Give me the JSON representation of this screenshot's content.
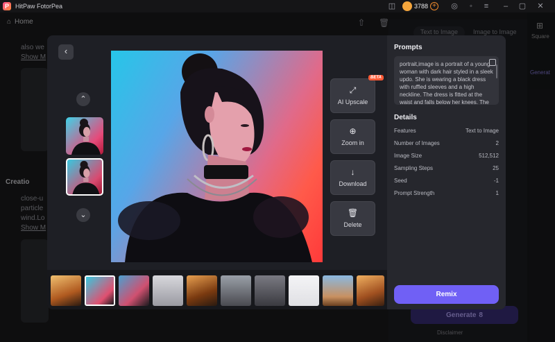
{
  "app": {
    "title": "HitPaw FotorPea",
    "logo": "P",
    "credits": "3788"
  },
  "background": {
    "home_label": "Home",
    "text_1": "also we",
    "link_1": "Show M",
    "creation_label": "Creatio",
    "text_2a": "close-u",
    "text_2b": "particle",
    "text_2c": "wind.Lo",
    "link_2": "Show M",
    "tab_text_to_image": "Text to Image",
    "tab_image_to_image": "Image to Image",
    "sidebar_square": "Square",
    "sidebar_generate": "Generat",
    "generate_label": "Generate",
    "generate_cost": "8",
    "disclaimer": "Disclaimer"
  },
  "modal": {
    "back_icon": "‹",
    "nav_up_icon": "⌃",
    "nav_down_icon": "⌄",
    "actions": [
      {
        "label": "AI Upscale",
        "icon": "⤢"
      },
      {
        "label": "Zoom in",
        "icon": "⊕"
      },
      {
        "label": "Download",
        "icon": "↓"
      },
      {
        "label": "Delete",
        "icon": "🗑"
      }
    ],
    "beta_badge": "BETA",
    "panel": {
      "prompts_title": "Prompts",
      "prompt_text": "portrait,image is a portrait of a young woman with dark hair styled in a sleek updo. She is wearing a black dress with ruffled sleeves and a high neckline. The dress is fitted at the waist and falls below her knees. The",
      "details_title": "Details",
      "details": [
        {
          "label": "Features",
          "value": "Text to Image"
        },
        {
          "label": "Number of Images",
          "value": "2"
        },
        {
          "label": "Image Size",
          "value": "512,512"
        },
        {
          "label": "Sampling Steps",
          "value": "25"
        },
        {
          "label": "Seed",
          "value": "-1"
        },
        {
          "label": "Prompt Strength",
          "value": "1"
        }
      ],
      "remix_label": "Remix"
    }
  }
}
